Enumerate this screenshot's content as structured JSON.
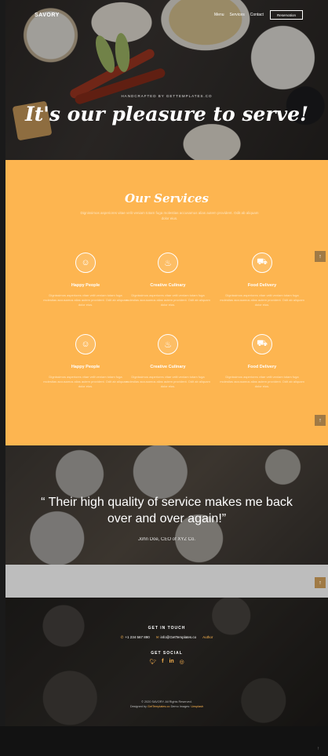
{
  "nav": {
    "brand": "SAVORY",
    "menu": [
      "Menu",
      "Services",
      "Contact"
    ],
    "reservation": "Reservation"
  },
  "hero": {
    "tagline": "HANDCRAFTED BY GETTEMPLATES.CO",
    "headline": "It's our pleasure to serve!"
  },
  "services": {
    "title": "Our Services",
    "subtitle": "Dignissimos asperiores vitae velit veniam totam fuga molestias accusamus alias autem provident. Odit ab aliquam dolor eius.",
    "items": [
      {
        "name": "Happy People",
        "icon": "smile-icon",
        "desc": "Dignissimos asperiores vitae velit veniam totam fuga molestias accusamus alias autem provident. Odit ab aliquam dolor eius."
      },
      {
        "name": "Creative Culinary",
        "icon": "bell-icon",
        "desc": "Dignissimos asperiores vitae velit veniam totam fuga molestias accusamus alias autem provident. Odit ab aliquam dolor eius."
      },
      {
        "name": "Food Delivery",
        "icon": "truck-icon",
        "desc": "Dignissimos asperiores vitae velit veniam totam fuga molestias accusamus alias autem provident. Odit ab aliquam dolor eius."
      },
      {
        "name": "Happy People",
        "icon": "smile-icon",
        "desc": "Dignissimos asperiores vitae velit veniam totam fuga molestias accusamus alias autem provident. Odit ab aliquam dolor eius."
      },
      {
        "name": "Creative Culinary",
        "icon": "bell-icon",
        "desc": "Dignissimos asperiores vitae velit veniam totam fuga molestias accusamus alias autem provident. Odit ab aliquam dolor eius."
      },
      {
        "name": "Food Delivery",
        "icon": "truck-icon",
        "desc": "Dignissimos asperiores vitae velit veniam totam fuga molestias accusamus alias autem provident. Odit ab aliquam dolor eius."
      }
    ]
  },
  "testimonial": {
    "quote": "“ Their high quality of service makes me back over and over again!”",
    "author": "John Doe, CEO of XYZ Co."
  },
  "footer": {
    "get_in_touch": "GET IN TOUCH",
    "phone": "+1 234 567 890",
    "email": "info@GetTemplates.co",
    "author": "Author",
    "get_social": "GET SOCIAL",
    "social_icons": [
      "twitter-icon",
      "facebook-icon",
      "linkedin-icon",
      "dribbble-icon"
    ],
    "copyright": "© 2020 SAVORY. All Rights Reserved.",
    "designed_prefix": "Designed by",
    "designed_by": "GetTemplates.co",
    "demo_prefix": "Demo Images:",
    "demo_images": "Unsplash"
  },
  "colors": {
    "accent": "#fdb550",
    "button_dark": "#a07a45"
  }
}
